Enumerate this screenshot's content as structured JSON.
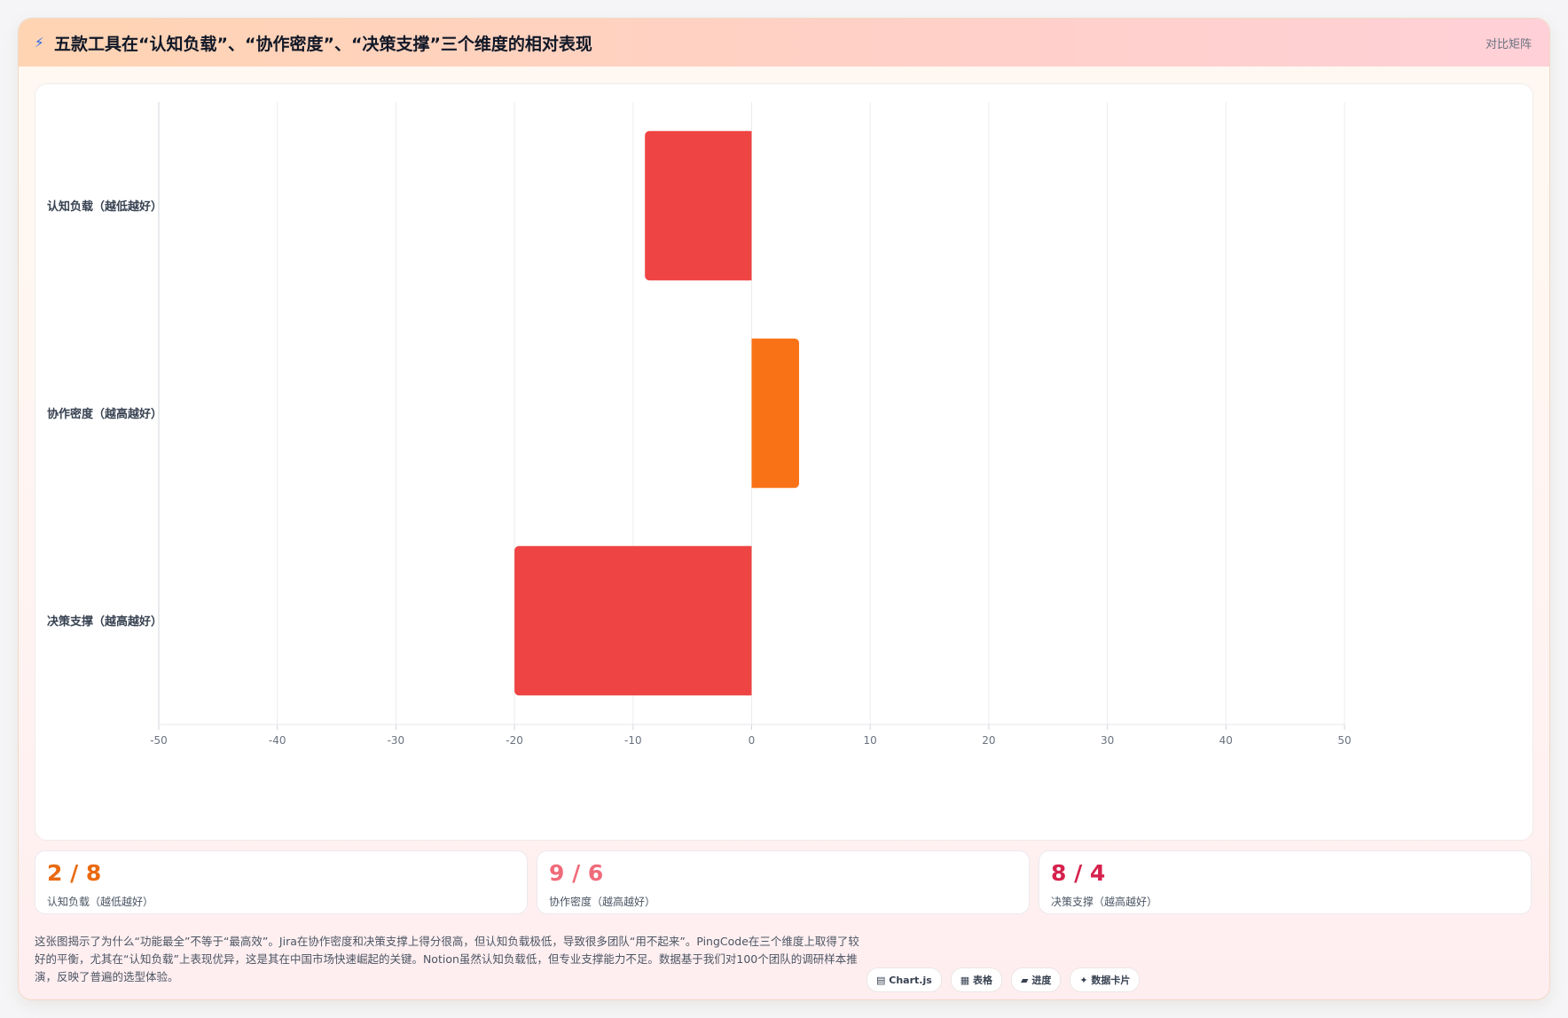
{
  "header": {
    "icon": "lightning-icon",
    "title": "五款工具在“认知负载”、“协作密度”、“决策支撑”三个维度的相对表现",
    "tag": "对比矩阵"
  },
  "chart_data": {
    "type": "bar",
    "orientation": "horizontal",
    "categories": [
      "认知负载（越低越好）",
      "协作密度（越高越好）",
      "决策支撑（越高越好）"
    ],
    "values": [
      -9,
      4,
      -20
    ],
    "colors": [
      "#ef4444",
      "#f97316",
      "#ef4444"
    ],
    "xlim": [
      -50,
      50
    ],
    "xticks": [
      "-50",
      "-40",
      "-30",
      "-20",
      "-10",
      "0",
      "10",
      "20",
      "30",
      "40",
      "50"
    ],
    "grid": true,
    "legend": "none"
  },
  "stats": [
    {
      "value": "2 / 8",
      "label": "认知负载（越低越好）",
      "color": "#ea6a10"
    },
    {
      "value": "9 / 6",
      "label": "协作密度（越高越好）",
      "color": "#f06b7a"
    },
    {
      "value": "8 / 4",
      "label": "决策支撑（越高越好）",
      "color": "#d6224d"
    }
  ],
  "description": "这张图揭示了为什么“功能最全”不等于“最高效”。Jira在协作密度和决策支撑上得分很高，但认知负载极低，导致很多团队“用不起来”。PingCode在三个维度上取得了较好的平衡，尤其在“认知负载”上表现优异，这是其在中国市场快速崛起的关键。Notion虽然认知负载低，但专业支撑能力不足。数据基于我们对100个团队的调研样本推演，反映了普遍的选型体验。",
  "pills": [
    {
      "icon": "chart-icon",
      "glyph": "▤",
      "label": "Chart.js"
    },
    {
      "icon": "table-icon",
      "glyph": "▦",
      "label": "表格"
    },
    {
      "icon": "progress-icon",
      "glyph": "▰",
      "label": "进度"
    },
    {
      "icon": "sparkle-icon",
      "glyph": "✦",
      "label": "数据卡片"
    }
  ]
}
